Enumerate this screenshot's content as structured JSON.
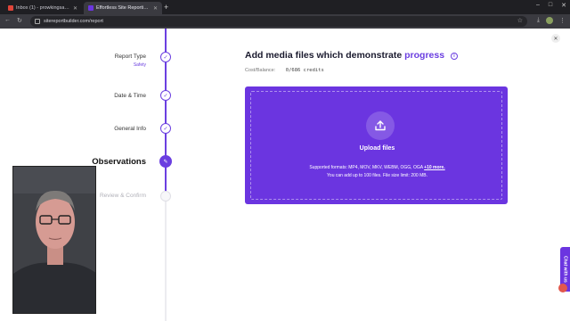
{
  "browser": {
    "tabs": [
      {
        "title": "Inbox (1) - prowkingsafety@gmail.com",
        "favicon_color": "#e0453a",
        "active": false
      },
      {
        "title": "Effortless Site Reporting for Construction",
        "favicon_color": "#6b35e0",
        "active": true
      }
    ],
    "new_tab_label": "+",
    "url": "sitereportbuilder.com/report"
  },
  "stepper": {
    "steps": [
      {
        "label": "Report Type",
        "sublabel": "Safety",
        "state": "done"
      },
      {
        "label": "Date & Time",
        "sublabel": "",
        "state": "done"
      },
      {
        "label": "General Info",
        "sublabel": "",
        "state": "done"
      },
      {
        "label": "Observations",
        "sublabel": "",
        "state": "current"
      },
      {
        "label": "Review & Confirm",
        "sublabel": "",
        "state": "pending"
      }
    ]
  },
  "main": {
    "heading_prefix": "Add media files which demonstrate",
    "heading_accent": "progress",
    "cost_label": "Cost/Balance:",
    "cost_value": "0/686 credits",
    "upload": {
      "title": "Upload files",
      "formats_prefix": "Supported formats: MP4, MOV, MKV, WEBM, OGG, OGA",
      "formats_more": "+10 more.",
      "limits": "You can add up to 100 files. File size limit: 200 MB."
    }
  },
  "chat_widget_label": "Chat with us",
  "colors": {
    "accent": "#6b35e0",
    "rail": "#6b3fe0"
  }
}
